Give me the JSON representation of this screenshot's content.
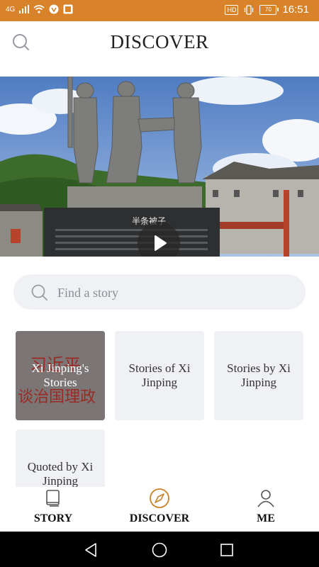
{
  "status_bar": {
    "network": "4G",
    "hd_badge": "HD",
    "battery": "70",
    "time": "16:51"
  },
  "header": {
    "title": "DISCOVER",
    "search_icon": "search-icon"
  },
  "hero": {
    "media": "video-thumbnail",
    "play_icon": "play-icon",
    "plaque_title": "半条被子"
  },
  "search": {
    "placeholder": "Find a story",
    "value": ""
  },
  "categories": [
    {
      "label": "Xi Jinping's Stories",
      "bg_text_top": "习近平",
      "bg_text_bottom": "谈治国理政"
    },
    {
      "label": "Stories of Xi Jinping"
    },
    {
      "label": "Stories by Xi Jinping"
    },
    {
      "label": "Quoted by Xi Jinping"
    }
  ],
  "tabs": [
    {
      "label": "STORY",
      "icon": "book-icon",
      "active": false
    },
    {
      "label": "DISCOVER",
      "icon": "compass-icon",
      "active": true
    },
    {
      "label": "ME",
      "icon": "user-icon",
      "active": false
    }
  ],
  "colors": {
    "status_bar": "#d88229",
    "accent": "#c8822c",
    "tile_bg": "#f0f1f5",
    "text": "#222222"
  }
}
